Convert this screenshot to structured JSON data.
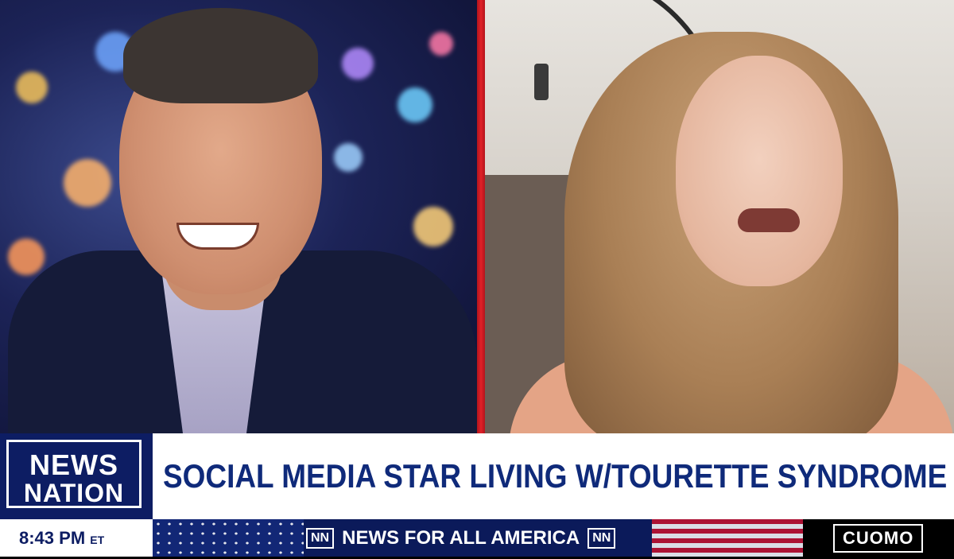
{
  "network": {
    "logo_line1": "NEWS",
    "logo_line2": "NATION"
  },
  "chyron": {
    "headline": "SOCIAL MEDIA STAR LIVING W/TOURETTE SYNDROME"
  },
  "ticker": {
    "time": "8:43 PM",
    "timezone": "ET",
    "badge_left": "NN",
    "slogan": "NEWS FOR ALL AMERICA",
    "badge_right": "NN",
    "show_name": "CUOMO"
  },
  "colors": {
    "brand_navy": "#0d1d63",
    "headline_blue": "#0f2a7a",
    "divider_red": "#e02128"
  }
}
